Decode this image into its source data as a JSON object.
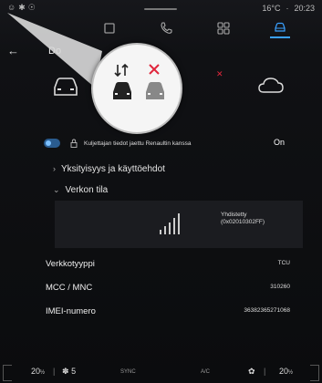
{
  "statusbar": {
    "temperature": "16°C",
    "separator": "·",
    "time": "20:23"
  },
  "appbar": {
    "items": [
      {
        "icon": "media-icon"
      },
      {
        "icon": "phone-icon"
      },
      {
        "icon": "apps-icon"
      },
      {
        "icon": "vehicle-icon",
        "active": true
      }
    ]
  },
  "header": {
    "back_icon": "back-arrow-icon",
    "title": "Do"
  },
  "magnifier": {
    "left_icon": "car-data-transfer-icon",
    "right_icon": "car-no-data-icon"
  },
  "consent": {
    "label": "Kuljettajan tiedot jaettu Renaultin kanssa",
    "state": "On"
  },
  "sections": {
    "privacy": "Yksityisyys ja käyttöehdot",
    "network": "Verkon tila"
  },
  "network": {
    "status_line1": "Yhdistetty",
    "status_line2": "(0x02010302FF)"
  },
  "info": [
    {
      "label": "Verkkotyyppi",
      "value": "TCU"
    },
    {
      "label": "MCC / MNC",
      "value": "310260"
    },
    {
      "label": "IMEI-numero",
      "value": "36382365271068"
    }
  ],
  "bottombar": {
    "left_temp": "20",
    "left_temp_unit": "½",
    "fan_speed": "5",
    "sync": "SYNC",
    "ac": "A/C",
    "right_temp": "20",
    "right_temp_unit": "½"
  },
  "colors": {
    "accent": "#3aa0ff",
    "alert": "#e0263c"
  }
}
